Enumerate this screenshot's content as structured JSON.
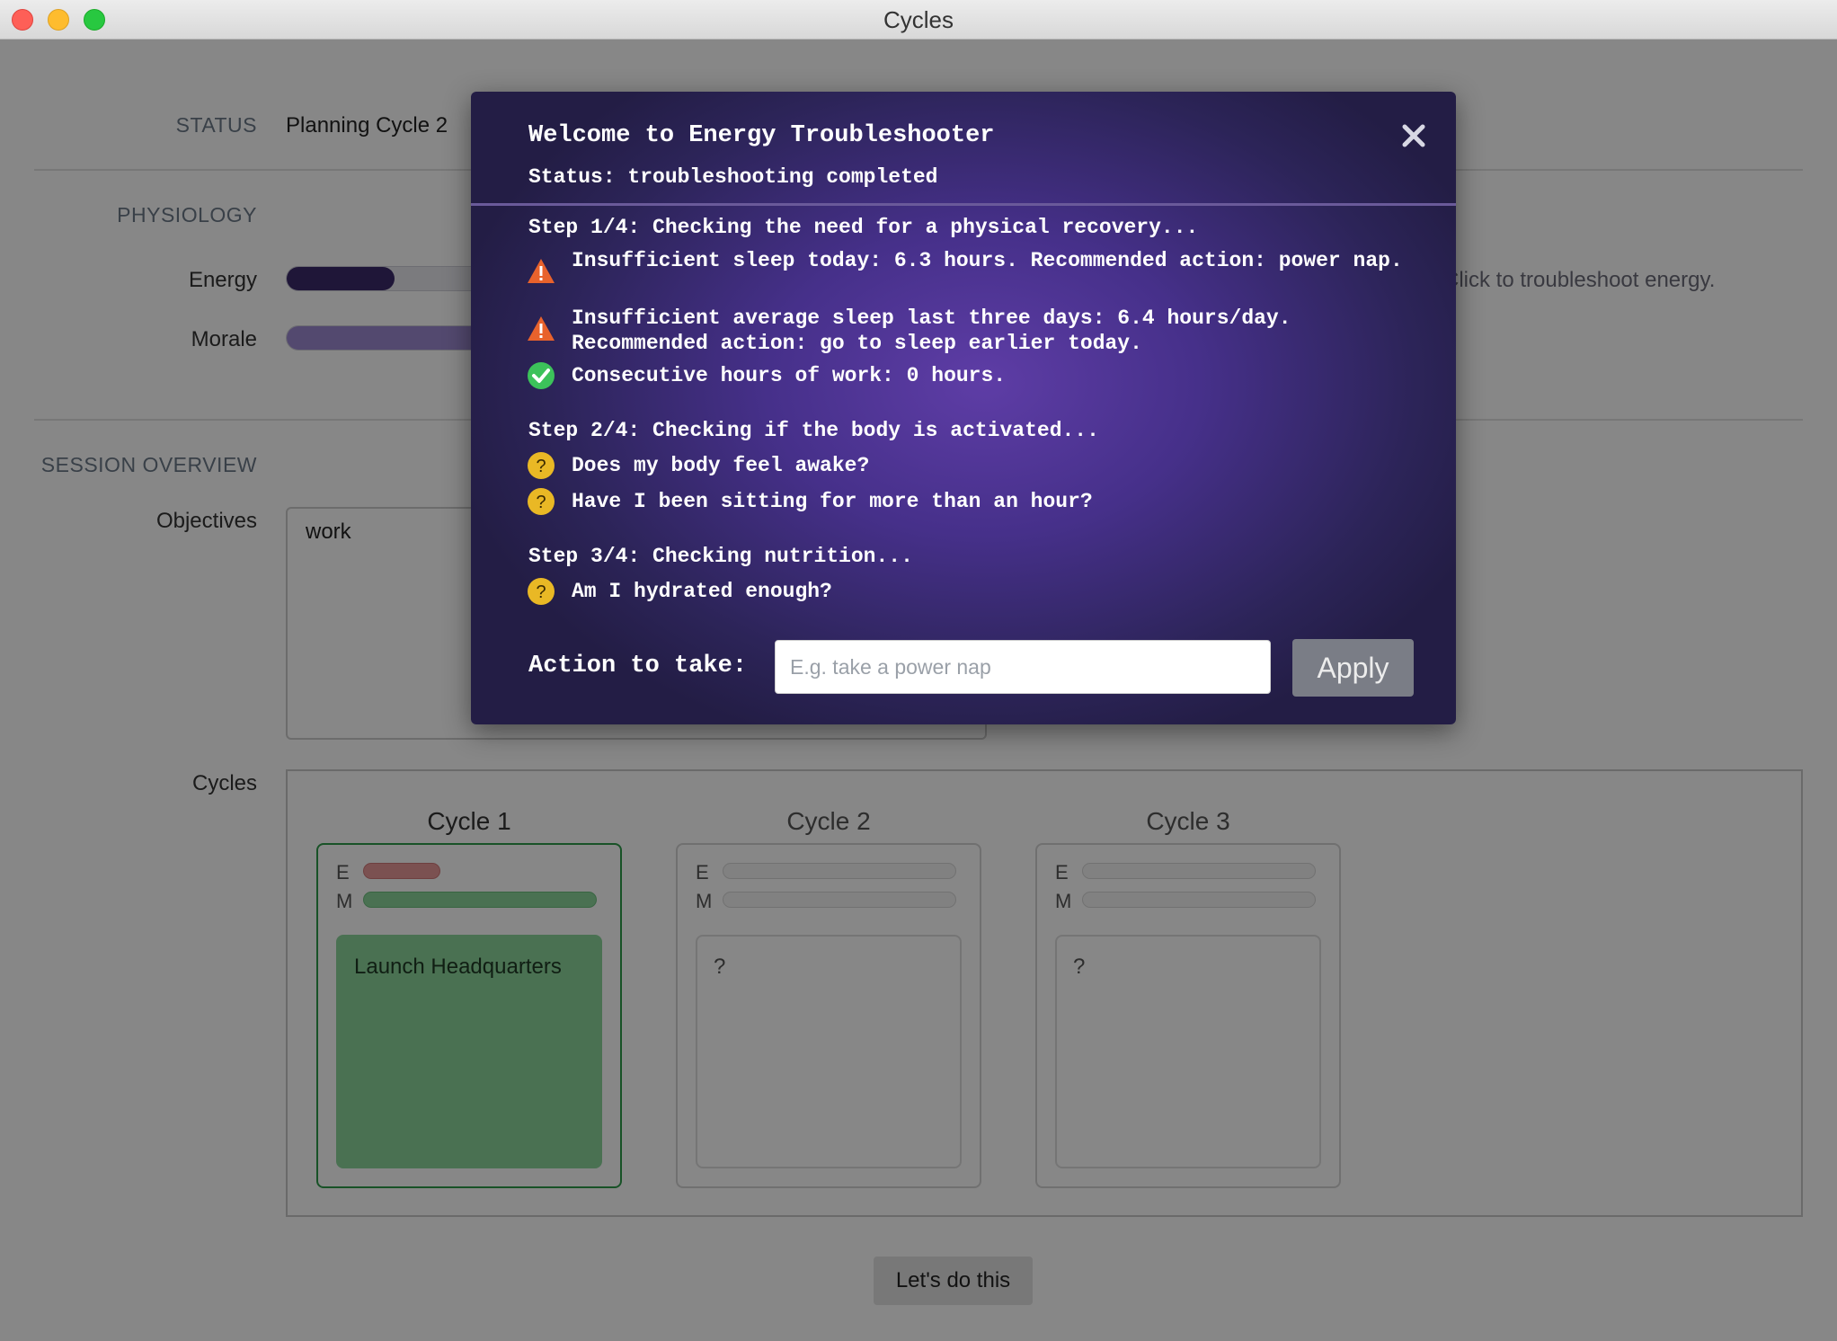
{
  "window": {
    "title": "Cycles"
  },
  "status": {
    "label": "STATUS",
    "value": "Planning Cycle 2"
  },
  "physiology": {
    "label": "PHYSIOLOGY",
    "energy": {
      "label": "Energy",
      "level": 0.1,
      "color": "#3b2a6b"
    },
    "morale": {
      "label": "Morale",
      "level": 1.0,
      "color": "#9e8bd1"
    },
    "troubleshoot_text": "Click to troubleshoot energy."
  },
  "session": {
    "label": "SESSION OVERVIEW",
    "objectives_label": "Objectives",
    "objectives_value": "work",
    "cycles_label": "Cycles",
    "cycles": [
      {
        "title": "Cycle 1",
        "e_label": "E",
        "m_label": "M",
        "energy_level": 0.33,
        "morale_level": 1.0,
        "note": "Launch Headquarters",
        "active": true
      },
      {
        "title": "Cycle 2",
        "e_label": "E",
        "m_label": "M",
        "energy_level": 0,
        "morale_level": 0,
        "note": "?",
        "active": false
      },
      {
        "title": "Cycle 3",
        "e_label": "E",
        "m_label": "M",
        "energy_level": 0,
        "morale_level": 0,
        "note": "?",
        "active": false
      }
    ]
  },
  "go_button": "Let's do this",
  "modal": {
    "title": "Welcome to Energy Troubleshooter",
    "status": "Status: troubleshooting completed",
    "steps": [
      {
        "heading": "Step 1/4: Checking the need for a physical recovery...",
        "items": [
          {
            "icon": "warning-icon",
            "text": "Insufficient sleep today: 6.3 hours. Recommended action: power nap."
          },
          {
            "icon": "warning-icon",
            "text": "Insufficient average sleep last three days: 6.4 hours/day. Recommended action: go to sleep earlier today."
          },
          {
            "icon": "check-icon",
            "text": "Consecutive hours of work: 0 hours."
          }
        ]
      },
      {
        "heading": "Step 2/4: Checking if the body is activated...",
        "items": [
          {
            "icon": "question-icon",
            "text": "Does my body feel awake?"
          },
          {
            "icon": "question-icon",
            "text": "Have I been sitting for more than an hour?"
          }
        ]
      },
      {
        "heading": "Step 3/4: Checking nutrition...",
        "items": [
          {
            "icon": "question-icon",
            "text": "Am I hydrated enough?"
          }
        ]
      }
    ],
    "action_label": "Action to take:",
    "action_input": {
      "value": "",
      "placeholder": "E.g. take a power nap"
    },
    "apply_label": "Apply"
  },
  "colors": {
    "warning": "#e8622c",
    "check": "#3cc25a",
    "question": "#e9b825",
    "active_cycle_border": "#2e9c4a",
    "active_cycle_note": "#8cd59c"
  }
}
